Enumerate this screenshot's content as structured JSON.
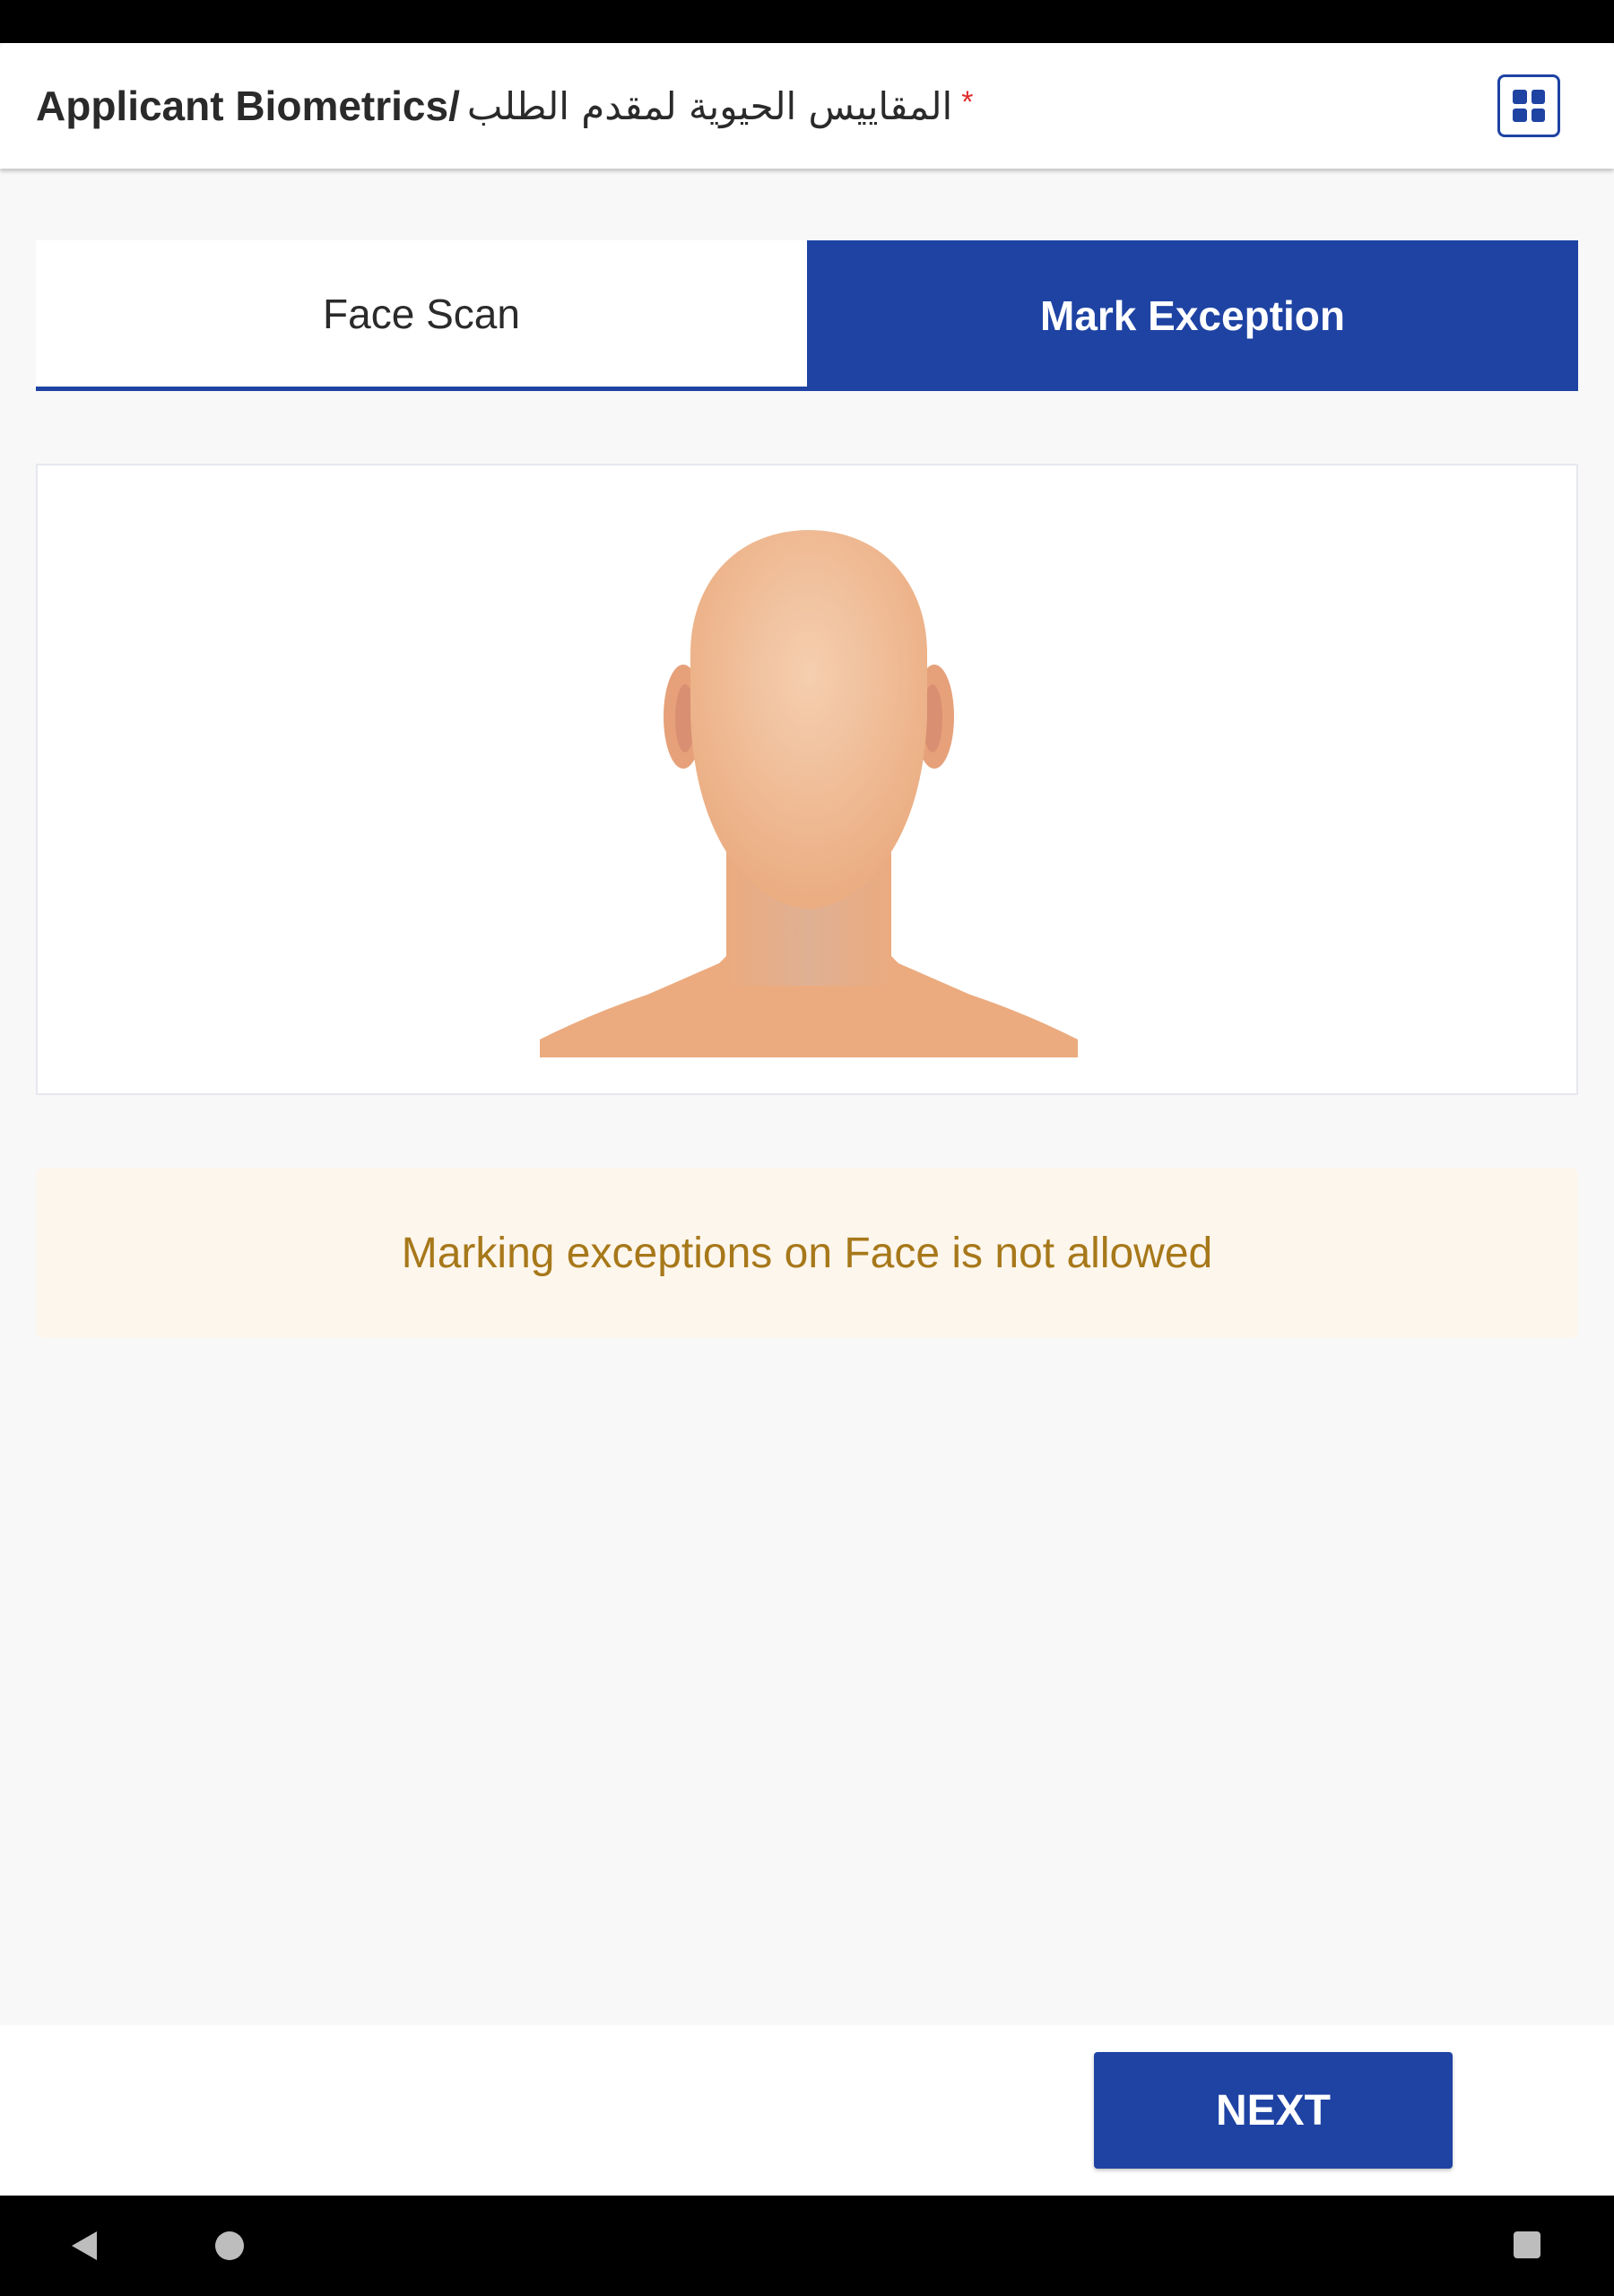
{
  "header": {
    "title_en": "Applicant Biometrics/",
    "title_ar": "المقاييس الحيوية لمقدم الطلب",
    "required_marker": "*",
    "menu_icon": "grid-icon"
  },
  "tabs": [
    {
      "label": "Face Scan",
      "active": false
    },
    {
      "label": "Mark Exception",
      "active": true
    }
  ],
  "face_panel": {
    "illustration": "face-silhouette"
  },
  "warning": {
    "message": "Marking exceptions on Face is not allowed"
  },
  "footer": {
    "next_label": "NEXT"
  },
  "colors": {
    "primary": "#1e43a3",
    "warning_text": "#a7781a",
    "warning_bg": "#fdf6ec",
    "required": "#e02b2b"
  },
  "nav": {
    "back_icon": "back-triangle-icon",
    "home_icon": "home-circle-icon",
    "recent_icon": "recent-square-icon"
  }
}
